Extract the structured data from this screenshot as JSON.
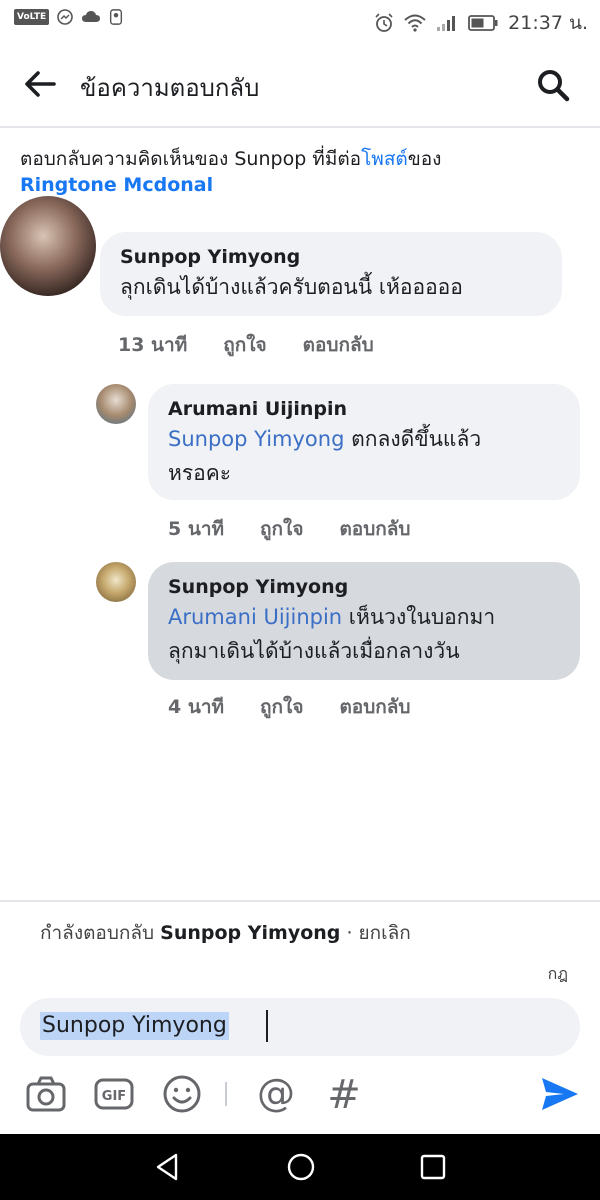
{
  "status_bar": {
    "network_label": "VoLTE",
    "time": "21:37 น."
  },
  "header": {
    "title": "ข้อความตอบกลับ"
  },
  "context": {
    "prefix": "ตอบกลับความคิดเห็นของ Sunpop ที่มีต่อ",
    "post_link": "โพสต์",
    "suffix": "ของ",
    "page_name": "Ringtone Mcdonal"
  },
  "comments": [
    {
      "author": "Sunpop Yimyong",
      "mention": "",
      "text": "ลุกเดินได้บ้างแล้วครับตอนนี้ เห้อออออ",
      "time": "13 นาที",
      "like": "ถูกใจ",
      "reply": "ตอบกลับ"
    },
    {
      "author": "Arumani Uijinpin",
      "mention": "Sunpop Yimyong",
      "text_line1": " ตกลงดีขึ้นแล้ว",
      "text_line2": "หรอคะ",
      "time": "5 นาที",
      "like": "ถูกใจ",
      "reply": "ตอบกลับ"
    },
    {
      "author": "Sunpop Yimyong",
      "mention": "Arumani Uijinpin",
      "text_line1": " เห็นวงในบอกมา",
      "text_line2": "ลุกมาเดินได้บ้างแล้วเมื่อกลางวัน",
      "time": "4 นาที",
      "like": "ถูกใจ",
      "reply": "ตอบกลับ"
    }
  ],
  "reply_bar": {
    "replying_prefix": "กำลังตอบกลับ ",
    "replying_name": "Sunpop Yimyong",
    "cancel": " · ยกเลิก",
    "rules": "กฎ",
    "input_value": "Sunpop Yimyong"
  },
  "toolbar": {
    "gif_label": "GIF",
    "at_label": "@",
    "hash_label": "#"
  },
  "colors": {
    "link_blue": "#1877f2",
    "mention_blue": "#3b6fc6",
    "bubble_gray": "#f0f2f5",
    "highlight_bubble": "#d6d9de",
    "send_blue": "#1877f2"
  }
}
